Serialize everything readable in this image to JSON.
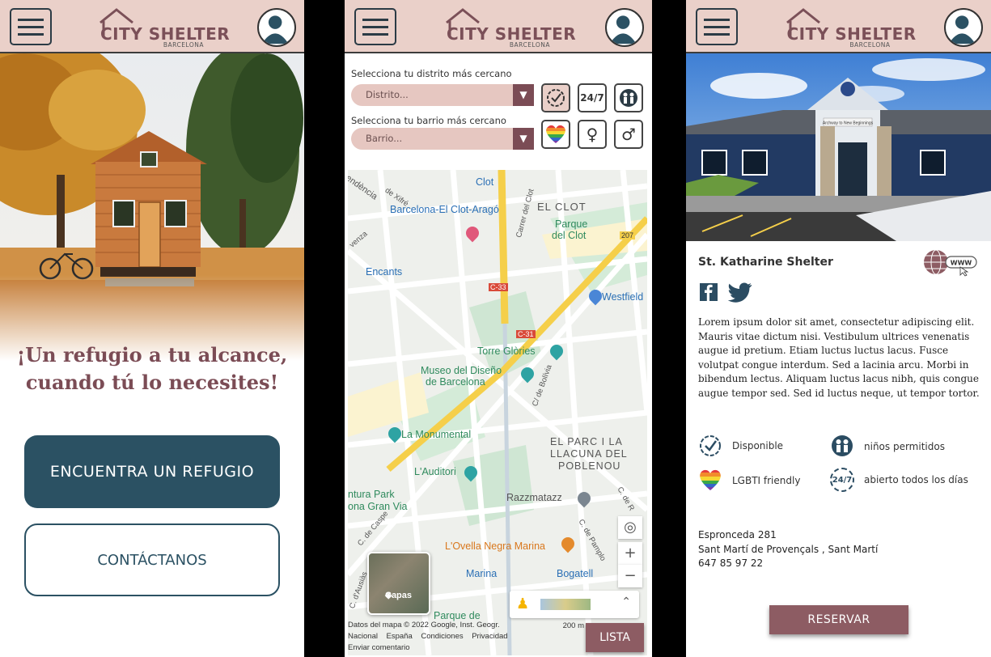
{
  "brand": {
    "name": "CITY SHELTER",
    "city": "BARCELONA"
  },
  "colors": {
    "header_bg": "#ead0c9",
    "primary": "#2b5163",
    "accent": "#8d5c63",
    "tagline": "#7b4c55"
  },
  "home": {
    "tagline_line1": "¡Un refugio a tu alcance,",
    "tagline_line2": "cuando tú lo necesites!",
    "find_button": "ENCUENTRA UN REFUGIO",
    "contact_button": "CONTÁCTANOS"
  },
  "search": {
    "district_label": "Selecciona tu distrito más cercano",
    "district_placeholder": "Distrito...",
    "barrio_label": "Selecciona tu barrio más cercano",
    "barrio_placeholder": "Barrio...",
    "filters": [
      "clock-check-icon",
      "24-7-icon",
      "children-icon",
      "lgbti-heart-icon",
      "female-icon",
      "male-icon"
    ],
    "filter_24_7": "24/7",
    "map_labels": {
      "clot": "Clot",
      "el_clot": "EL CLOT",
      "barcelona_el_clot": "Barcelona-El Clot-Aragó",
      "parque_del_clot_1": "Parque",
      "parque_del_clot_2": "del Clot",
      "encants": "Encants",
      "westfield": "Westfield",
      "torre_glories": "Torre Glòries",
      "museo_1": "Museo del Diseño",
      "museo_2": "de Barcelona",
      "monumental": "La Monumental",
      "auditori": "L'Auditori",
      "parc_1": "EL PARC I LA",
      "parc_2": "LLACUNA DEL",
      "parc_3": "POBLENOU",
      "razzmatazz": "Razzmatazz",
      "ntura_park": "ntura Park",
      "gran_via": "ona Gran Via",
      "ovella": "L'Ovella Negra Marina",
      "marina": "Marina",
      "bogatell": "Bogatell",
      "parque_de": "Parque de",
      "c33": "C-33",
      "c31": "C-31",
      "r207": "207",
      "carrer_del_clot": "Carrer del Clot",
      "bolivia": "C/ de Bolívia",
      "pamplona": "C. de Pamplo",
      "caspe": "C. de Caspe",
      "xifre": "de Xifré",
      "endencia": "endència",
      "venza": "venza",
      "ausias": "C. d'Ausiàs",
      "c_de_r": "C. de R"
    },
    "layers_label": "Capas",
    "scale": "200 m",
    "footer_line1": "Datos del mapa © 2022 Google, Inst. Geogr.",
    "footer_nacional": "Nacional",
    "footer_espana": "España",
    "footer_condiciones": "Condiciones",
    "footer_privacidad": "Privacidad",
    "footer_enviar": "Enviar comentario",
    "list_button": "LISTA",
    "zoom_in": "+",
    "zoom_out": "−"
  },
  "detail": {
    "name": "St. Katharine Shelter",
    "www": "WWW",
    "photo_sign": "Archway to New Beginnings",
    "description": "Lorem ipsum dolor sit amet, consectetur adipiscing elit. Mauris vitae dictum nisi. Vestibulum ultrices venenatis augue id pretium. Etiam luctus luctus lacus. Fusce volutpat congue interdum. Sed a lacinia arcu. Morbi in bibendum lectus. Aliquam luctus lacus nibh, quis congue augue tempor sed. Sed id luctus neque, ut tempor tortor.",
    "features": {
      "disponible": "Disponible",
      "ninos": "niños permitidos",
      "lgbti": "LGBTI friendly",
      "abierto": "abierto todos los días",
      "icon_24_7": "24/7"
    },
    "address_line1": "Espronceda 281",
    "address_line2": "Sant Martí de Provençals , Sant Martí",
    "phone": "647 85 97 22",
    "reserve_button": "RESERVAR"
  }
}
